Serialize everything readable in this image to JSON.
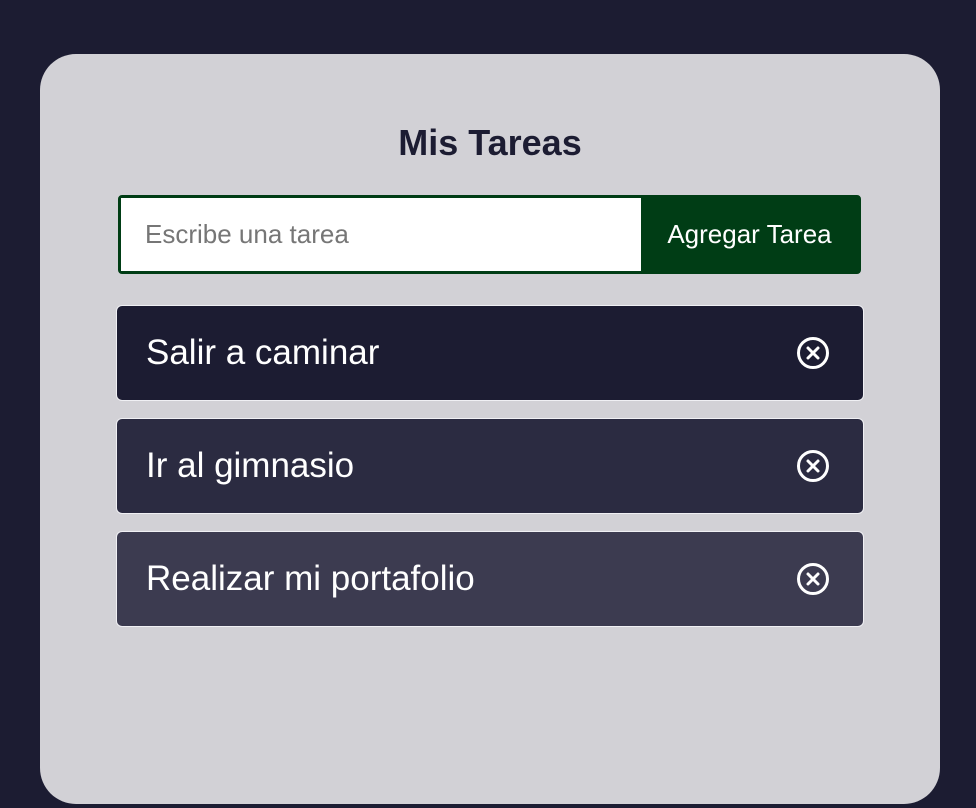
{
  "app": {
    "title": "Mis Tareas"
  },
  "form": {
    "input_placeholder": "Escribe una tarea",
    "input_value": "",
    "add_button_label": "Agregar Tarea"
  },
  "tasks": [
    {
      "text": "Salir a caminar",
      "color": "#1c1c32",
      "icon": "close-circle-icon"
    },
    {
      "text": "Ir al gimnasio",
      "color": "#2b2b41",
      "icon": "close-circle-icon"
    },
    {
      "text": "Realizar mi portafolio",
      "color": "#3c3b50",
      "icon": "close-circle-icon"
    }
  ],
  "colors": {
    "page_background": "#1c1c32",
    "card_background": "#d2d1d6",
    "accent": "#003d15",
    "title": "#1c1c32"
  }
}
